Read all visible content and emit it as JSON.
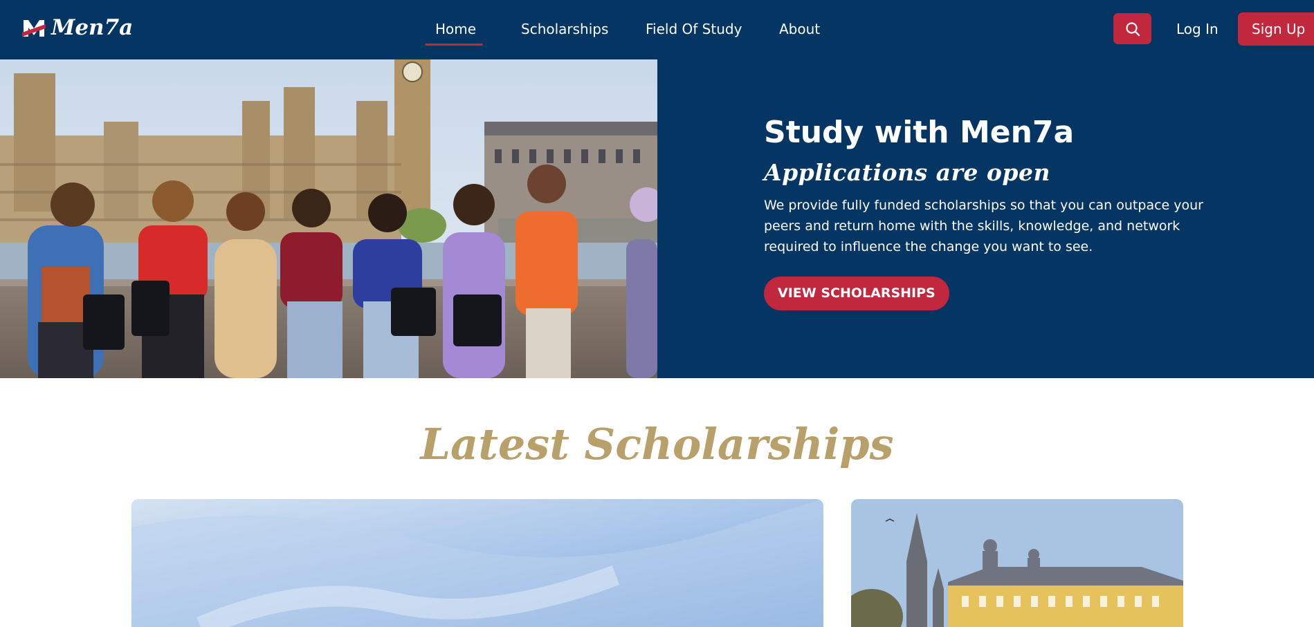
{
  "brand": {
    "name": "Men7a",
    "accent": "#c1283d",
    "navy": "#043563",
    "gold": "#b8a06a"
  },
  "nav": {
    "items": [
      {
        "label": "Home",
        "active": true
      },
      {
        "label": "Scholarships",
        "active": false
      },
      {
        "label": "Field Of Study",
        "active": false
      },
      {
        "label": "About",
        "active": false
      }
    ],
    "search_icon": "search-icon",
    "login_label": "Log In",
    "signup_label": "Sign Up"
  },
  "hero": {
    "title": "Study with Men7a",
    "subtitle": "Applications are open",
    "description": "We provide fully funded scholarships so that you can outpace your peers and return home with the skills, knowledge, and network required to influence the change you want to see.",
    "cta_label": "VIEW SCHOLARSHIPS"
  },
  "latest": {
    "title": "Latest Scholarships"
  }
}
